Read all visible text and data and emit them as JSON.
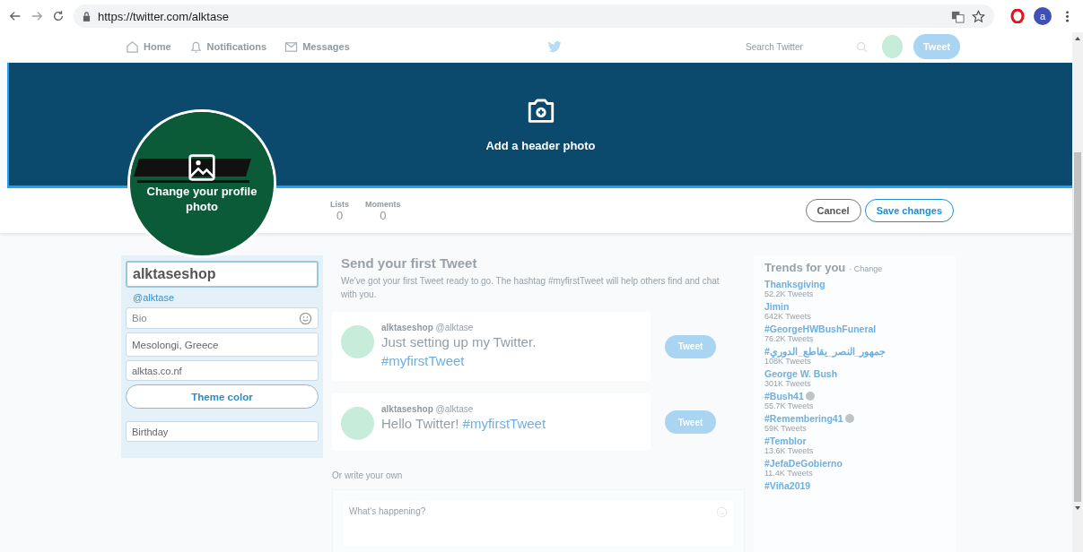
{
  "browser": {
    "url": "https://twitter.com/alktase",
    "profile_initial": "a"
  },
  "nav": {
    "items": [
      {
        "label": "Home"
      },
      {
        "label": "Notifications"
      },
      {
        "label": "Messages"
      }
    ],
    "search_placeholder": "Search Twitter",
    "tweet_button": "Tweet"
  },
  "header": {
    "label": "Add a header photo"
  },
  "avatar": {
    "label": "Change your profile photo"
  },
  "stats": [
    {
      "label": "Lists",
      "value": "0"
    },
    {
      "label": "Moments",
      "value": "0"
    }
  ],
  "actions": {
    "cancel": "Cancel",
    "save": "Save changes"
  },
  "profile_form": {
    "name": "alktaseshop",
    "handle": "@alktase",
    "bio_placeholder": "Bio",
    "location": "Mesolongi, Greece",
    "website": "alktas.co.nf",
    "theme_button": "Theme color",
    "birthday": "Birthday"
  },
  "first_tweet": {
    "title": "Send your first Tweet",
    "description": "We've got your first Tweet ready to go. The hashtag #myfirstTweet will help others find and chat with you.",
    "suggestions": [
      {
        "name": "alktaseshop",
        "handle": "@alktase",
        "text": "Just setting up my Twitter.",
        "hashtag": "#myfirstTweet",
        "button": "Tweet"
      },
      {
        "name": "alktaseshop",
        "handle": "@alktase",
        "text": "Hello Twitter!",
        "hashtag": "#myfirstTweet",
        "button": "Tweet"
      }
    ]
  },
  "write_own": {
    "label": "Or write your own",
    "placeholder": "What's happening?"
  },
  "trends": {
    "title": "Trends for you",
    "change": "· Change",
    "items": [
      {
        "name": "Thanksgiving",
        "count": "52.2K Tweets",
        "emoji": false
      },
      {
        "name": "Jimin",
        "count": "642K Tweets",
        "emoji": false
      },
      {
        "name": "#GeorgeHWBushFuneral",
        "count": "76.2K Tweets",
        "emoji": false
      },
      {
        "name": "#جمهور_النصر_يقاطع_الدوري",
        "count": "108K Tweets",
        "emoji": false
      },
      {
        "name": "George W. Bush",
        "count": "301K Tweets",
        "emoji": false
      },
      {
        "name": "#Bush41",
        "count": "55.7K Tweets",
        "emoji": true
      },
      {
        "name": "#Remembering41",
        "count": "59K Tweets",
        "emoji": true
      },
      {
        "name": "#Temblor",
        "count": "13.6K Tweets",
        "emoji": false
      },
      {
        "name": "#JefaDeGobierno",
        "count": "11.4K Tweets",
        "emoji": false
      },
      {
        "name": "#Viña2019",
        "emoji": false
      }
    ]
  }
}
